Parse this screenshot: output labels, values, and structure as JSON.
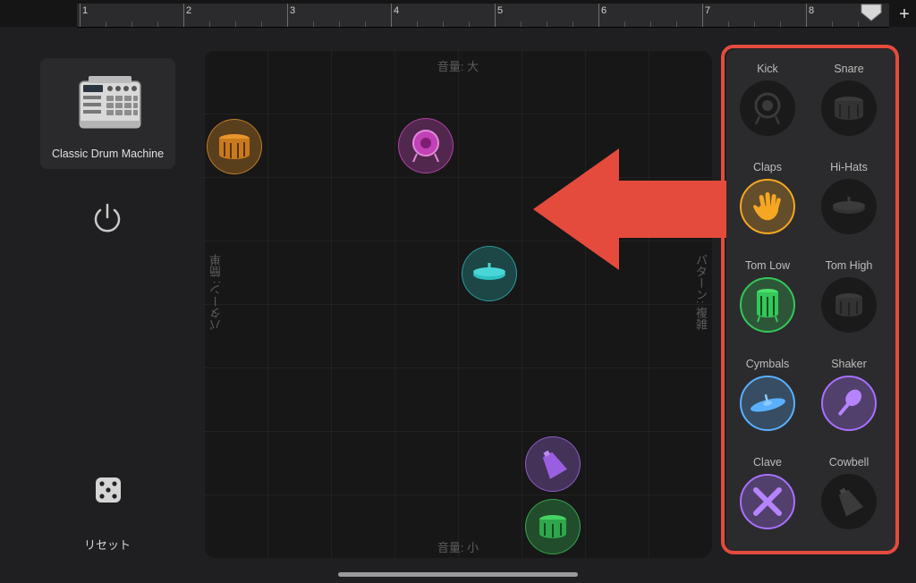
{
  "timeline": {
    "bars": [
      "1",
      "2",
      "3",
      "4",
      "5",
      "6",
      "7",
      "8"
    ],
    "add_button": "+"
  },
  "kit": {
    "name": "Classic Drum Machine",
    "icon": "drum-machine-icon"
  },
  "controls": {
    "power_icon": "power-icon",
    "reset_label": "リセット",
    "dice_icon": "dice-icon"
  },
  "pad": {
    "top_label": "音量: 大",
    "bottom_label": "音量: 小",
    "left_label": "パターン: 簡単",
    "right_label": "パターン: 複雑",
    "dots": [
      {
        "instrument": "Snare",
        "icon": "snare-drum-icon",
        "color": "#e8962a"
      },
      {
        "instrument": "Kick",
        "icon": "kick-drum-icon",
        "color": "#d04ac4"
      },
      {
        "instrument": "Hi-Hats",
        "icon": "hihat-icon",
        "color": "#2fc1c1"
      },
      {
        "instrument": "Cowbell",
        "icon": "cowbell-icon",
        "color": "#a66ce6"
      },
      {
        "instrument": "Tom Low",
        "icon": "tom-drum-icon",
        "color": "#3cc25a"
      }
    ]
  },
  "instruments": [
    {
      "name": "Kick",
      "icon": "kick-drum-icon",
      "active": false
    },
    {
      "name": "Snare",
      "icon": "snare-drum-icon",
      "active": false
    },
    {
      "name": "Claps",
      "icon": "hand-clap-icon",
      "active": true,
      "color": "#f5a623"
    },
    {
      "name": "Hi-Hats",
      "icon": "hihat-icon",
      "active": false
    },
    {
      "name": "Tom Low",
      "icon": "tom-drum-icon",
      "active": true,
      "color": "#34c759"
    },
    {
      "name": "Tom High",
      "icon": "tom-drum-icon",
      "active": false
    },
    {
      "name": "Cymbals",
      "icon": "cymbal-icon",
      "active": true,
      "color": "#5ab0ff"
    },
    {
      "name": "Shaker",
      "icon": "maraca-icon",
      "active": true,
      "color": "#a970ff"
    },
    {
      "name": "Clave",
      "icon": "clave-sticks-icon",
      "active": true,
      "color": "#a970ff"
    },
    {
      "name": "Cowbell",
      "icon": "cowbell-icon",
      "active": false
    }
  ],
  "colors": {
    "highlight": "#e44b3d",
    "panel": "#2b2b2d",
    "background": "#1f1f21"
  }
}
